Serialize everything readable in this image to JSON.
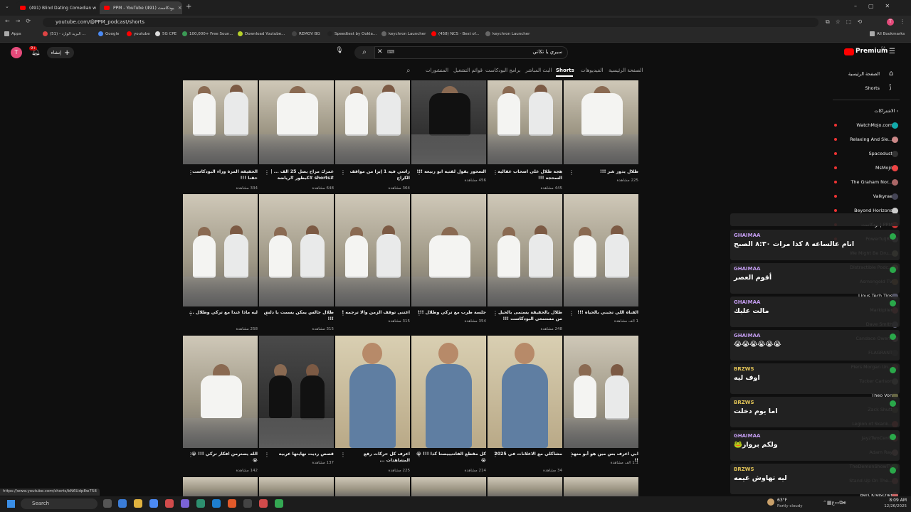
{
  "browser": {
    "tabs": [
      {
        "title": "(491) Blind Dating Comedian w",
        "active": false
      },
      {
        "title": "PPM - YouTube (491) بودكاست",
        "active": true
      }
    ],
    "url": "youtube.com/@PPM_podcast/shorts",
    "bookmarks": [
      "Apps",
      "البريد الوارد - (51) ...",
      "Google",
      "youtube",
      "5G CPE",
      "100,000+ Free Soun...",
      "Download Youtube...",
      "REMOV BG",
      "Speedtest by Ookla...",
      "keychron Launcher",
      "(458) NCS - Best of...",
      "keychron Launcher"
    ],
    "all_bookmarks": "All Bookmarks"
  },
  "youtube": {
    "brand": "Premium",
    "brand_sup": "SA",
    "search_value": "سيري يا تكاتي",
    "create_label": "إنشاء",
    "notif_count": "9+",
    "avatar_letter": "T",
    "channel_tabs": [
      "الصفحة الرئيسية",
      "الفيديوهات",
      "Shorts",
      "البث المباشر",
      "برامج البودكاست",
      "قوائم التشغيل",
      "المنشورات"
    ],
    "active_tab": "Shorts"
  },
  "sidebar": {
    "items": [
      {
        "label": "الصفحة الرئيسية",
        "icon": "home-icon"
      },
      {
        "label": "Shorts",
        "icon": "shorts-icon"
      }
    ],
    "subs_header": "الاشتراكات",
    "subscriptions": [
      "WatchMojo.com",
      "Relaxing And Sle...",
      "Spacedust",
      "MsMojo",
      "The Graham Nor...",
      "Valkyrae",
      "Beyond Horizons",
      "بودكاست | PPM",
      "PowerfulJRE",
      "We Might Be Dru...",
      "Distractible Podc...",
      "Asmongold TV",
      "Linus Tech Tips",
      "Markiplier",
      "Dave Smith",
      "Candace Owens",
      "FLAGRANT",
      "Piers Morgan Un...",
      "Tucker Carlson",
      "Theo Von",
      "Zack Shutt",
      "Legion of Skank...",
      "JayzTwoCents",
      "Adam Ray",
      "TheDemonShowTV",
      "Stand-Up On The...",
      "Bert Kreischer"
    ]
  },
  "shorts": [
    {
      "title": "الحقيقة المرة وراء البودكاست حقنا !!!",
      "views": "334 مشاهدة"
    },
    {
      "title": "عمرك مراح يصل 25 الف ... | #shorts #كبطور #رياضة",
      "views": "648 مشاهدة"
    },
    {
      "title": "راسي فيه 1 إبرا من مواقف الكراج",
      "views": "364 مشاهدة"
    },
    {
      "title": "السحور يقول لقتيه ابو ربيعه !!!",
      "views": "456 مشاهدة"
    },
    {
      "title": "هجة طلال على اصحاب عقالية السحجة !!!",
      "views": "445 مشاهدة"
    },
    {
      "title": "طلال يدور شر !!!",
      "views": "225 مشاهدة"
    },
    {
      "title": "ليه ماذا عندا مع تركي وطلال ...",
      "views": "258 مشاهدة"
    },
    {
      "title": "طلال جالس يمكن يسمت يا دلس !!!",
      "views": "315 مشاهدة"
    },
    {
      "title": "اعتنى توقف الزمن والا ترجمه !",
      "views": "315 مشاهدة"
    },
    {
      "title": "جلسة طرب مع تركي وطلال !!!",
      "views": "354 مشاهدة"
    },
    {
      "title": "طلال بالحقيقة يستمى بالحيل من مستمعي البودكاست !!!",
      "views": "248 مشاهدة"
    },
    {
      "title": "الفناة اللي تجبني بالحياة !!!",
      "views": "1 الف مشاهدة"
    },
    {
      "title": "الله يسترمن افكار تركي !!! 😭😭",
      "views": "142 مشاهدة"
    },
    {
      "title": "قصص رديت نهايتها عربية",
      "views": "137 مشاهدة"
    },
    {
      "title": "اعرف كل حركات رفع المشاهدات ...",
      "views": "225 مشاهدة"
    },
    {
      "title": "كل مقطع الفانتيبيستا كذا !!! 😭😭",
      "views": "214 مشاهدة"
    },
    {
      "title": "مشاكلي مع الاعلانات في 2025",
      "views": "34 مشاهدة"
    },
    {
      "title": "ابي اعرف بس مين هو أبو منهد !!",
      "views": "1.1 الف مشاهدة"
    }
  ],
  "chat": [
    {
      "user": "GHAIMAA",
      "msg": "انام عالساعه ٨ كذا مرات ٨:٣٠ الصبح",
      "color": "#c39cf0"
    },
    {
      "user": "GHAIMAA",
      "msg": "أقوم العصر",
      "color": "#c39cf0"
    },
    {
      "user": "GHAIMAA",
      "msg": "مالت عليك",
      "color": "#c39cf0"
    },
    {
      "user": "GHAIMAA",
      "msg": "😭😭😭😭😭😭",
      "color": "#c39cf0"
    },
    {
      "user": "BRZWS",
      "msg": "اوف ليه",
      "color": "#e0c256"
    },
    {
      "user": "BRZWS",
      "msg": "اما يوم دخلت",
      "color": "#e0c256"
    },
    {
      "user": "GHAIMAA",
      "msg": "ولكم برواز🐸",
      "color": "#c39cf0"
    },
    {
      "user": "BRZWS",
      "msg": "ليه تهاوش غيمه",
      "color": "#e0c256"
    }
  ],
  "statusbar_url": "https://www.youtube.com/shorts/bN6Udp8w758",
  "taskbar": {
    "search": "Search",
    "weather_temp": "63°F",
    "weather_desc": "Partly cloudy",
    "time": "8:09 AM",
    "date": "12/26/2025"
  }
}
